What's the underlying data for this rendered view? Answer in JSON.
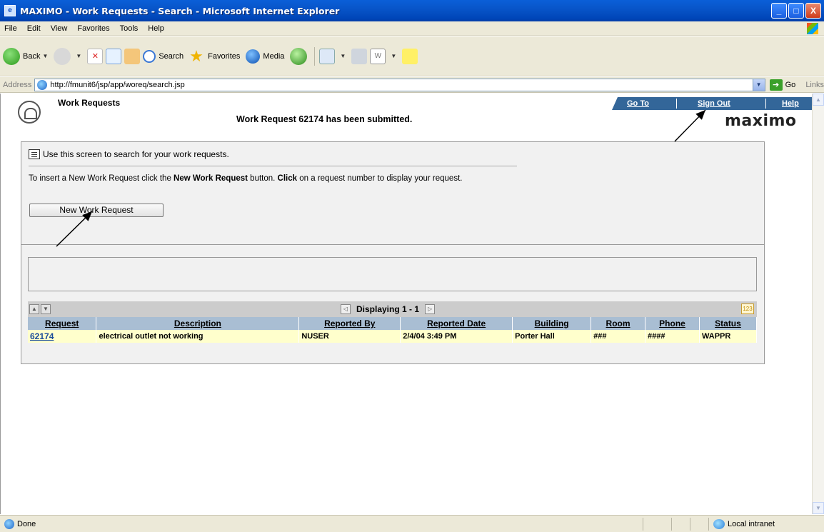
{
  "window": {
    "title": "MAXIMO - Work Requests - Search - Microsoft Internet Explorer",
    "minimize": "_",
    "maximize": "□",
    "close": "X"
  },
  "menu": [
    "File",
    "Edit",
    "View",
    "Favorites",
    "Tools",
    "Help"
  ],
  "toolbar": {
    "back": "Back",
    "search": "Search",
    "favorites": "Favorites",
    "media": "Media"
  },
  "address": {
    "label": "Address",
    "url": "http://fmunit6/jsp/app/woreq/search.jsp",
    "go": "Go",
    "links": "Links"
  },
  "app": {
    "title": "Work Requests",
    "message": "Work Request 62174 has been submitted.",
    "brand": "maximo",
    "nav": {
      "goto": "Go To",
      "signout": "Sign Out",
      "help": "Help"
    }
  },
  "panel": {
    "info": "Use this screen to search for your work requests.",
    "instr_pre": "To insert a New Work Request click the ",
    "instr_btn": "New Work Request",
    "instr_mid": " button. ",
    "instr_click": "Click",
    "instr_post": " on a request number to display your request.",
    "button": "New Work Request"
  },
  "results": {
    "displaying": "Displaying 1 - 1",
    "columns": [
      "Request",
      "Description",
      "Reported By",
      "Reported Date",
      "Building",
      "Room",
      "Phone",
      "Status"
    ],
    "rows": [
      [
        "62174",
        "electrical outlet not working",
        "NUSER",
        "2/4/04 3:49 PM",
        "Porter Hall",
        "###",
        "####",
        "WAPPR"
      ]
    ]
  },
  "status": {
    "text": "Done",
    "zone": "Local intranet"
  }
}
